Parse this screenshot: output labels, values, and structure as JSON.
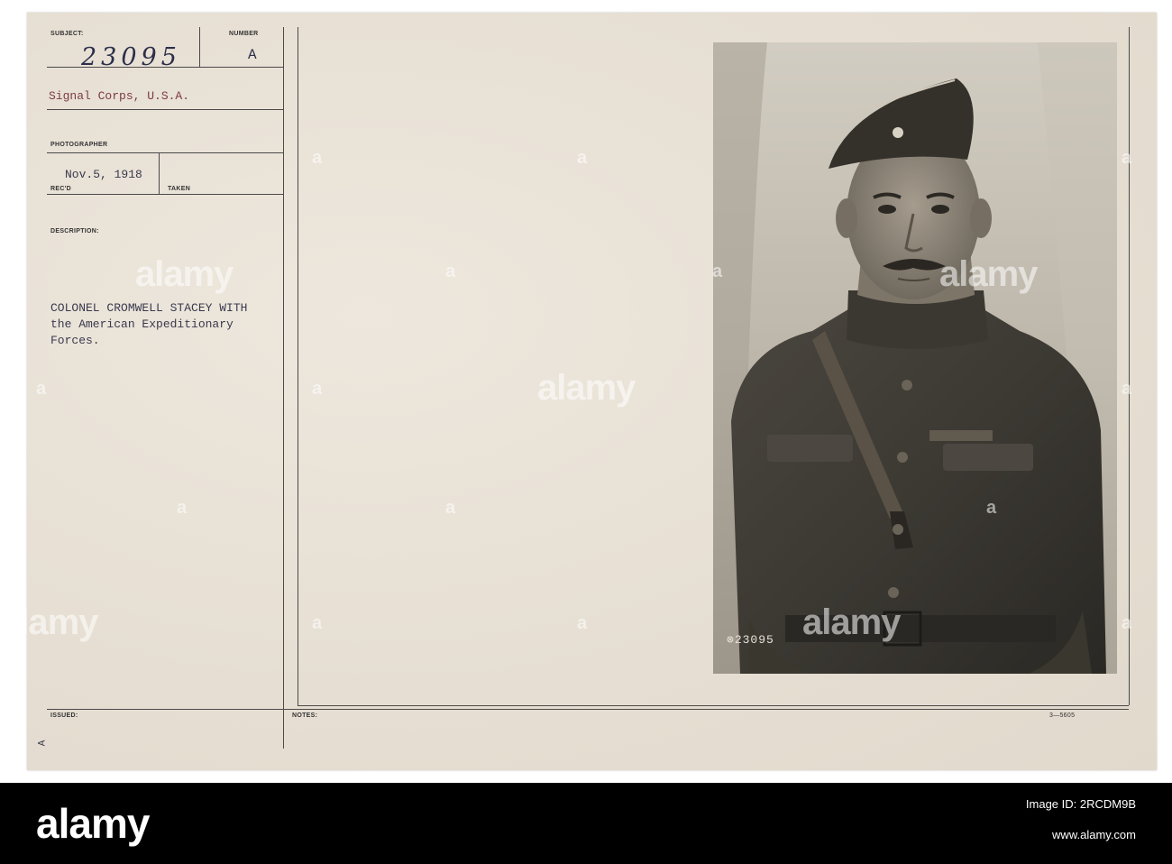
{
  "card": {
    "subject_label": "SUBJECT:",
    "number_label": "NUMBER",
    "number_handwritten": "23095",
    "number_mark": "A",
    "agency": "Signal Corps, U.S.A.",
    "photographer_label": "PHOTOGRAPHER",
    "received_date": "Nov.5, 1918",
    "recd_label": "REC'D",
    "taken_label": "TAKEN",
    "description_label": "DESCRIPTION:",
    "description_lines": [
      "COLONEL CROMWELL STACEY WITH",
      "the American Expeditionary",
      "Forces."
    ],
    "issued_label": "ISSUED:",
    "notes_label": "NOTES:",
    "form_code": "3—5605",
    "photo_number": "⊗23095",
    "corner_mark": "A"
  },
  "watermark": {
    "text": "alamy",
    "letter": "a"
  },
  "footer": {
    "logo": "alamy",
    "image_id": "Image ID: 2RCDM9B",
    "url": "www.alamy.com"
  }
}
